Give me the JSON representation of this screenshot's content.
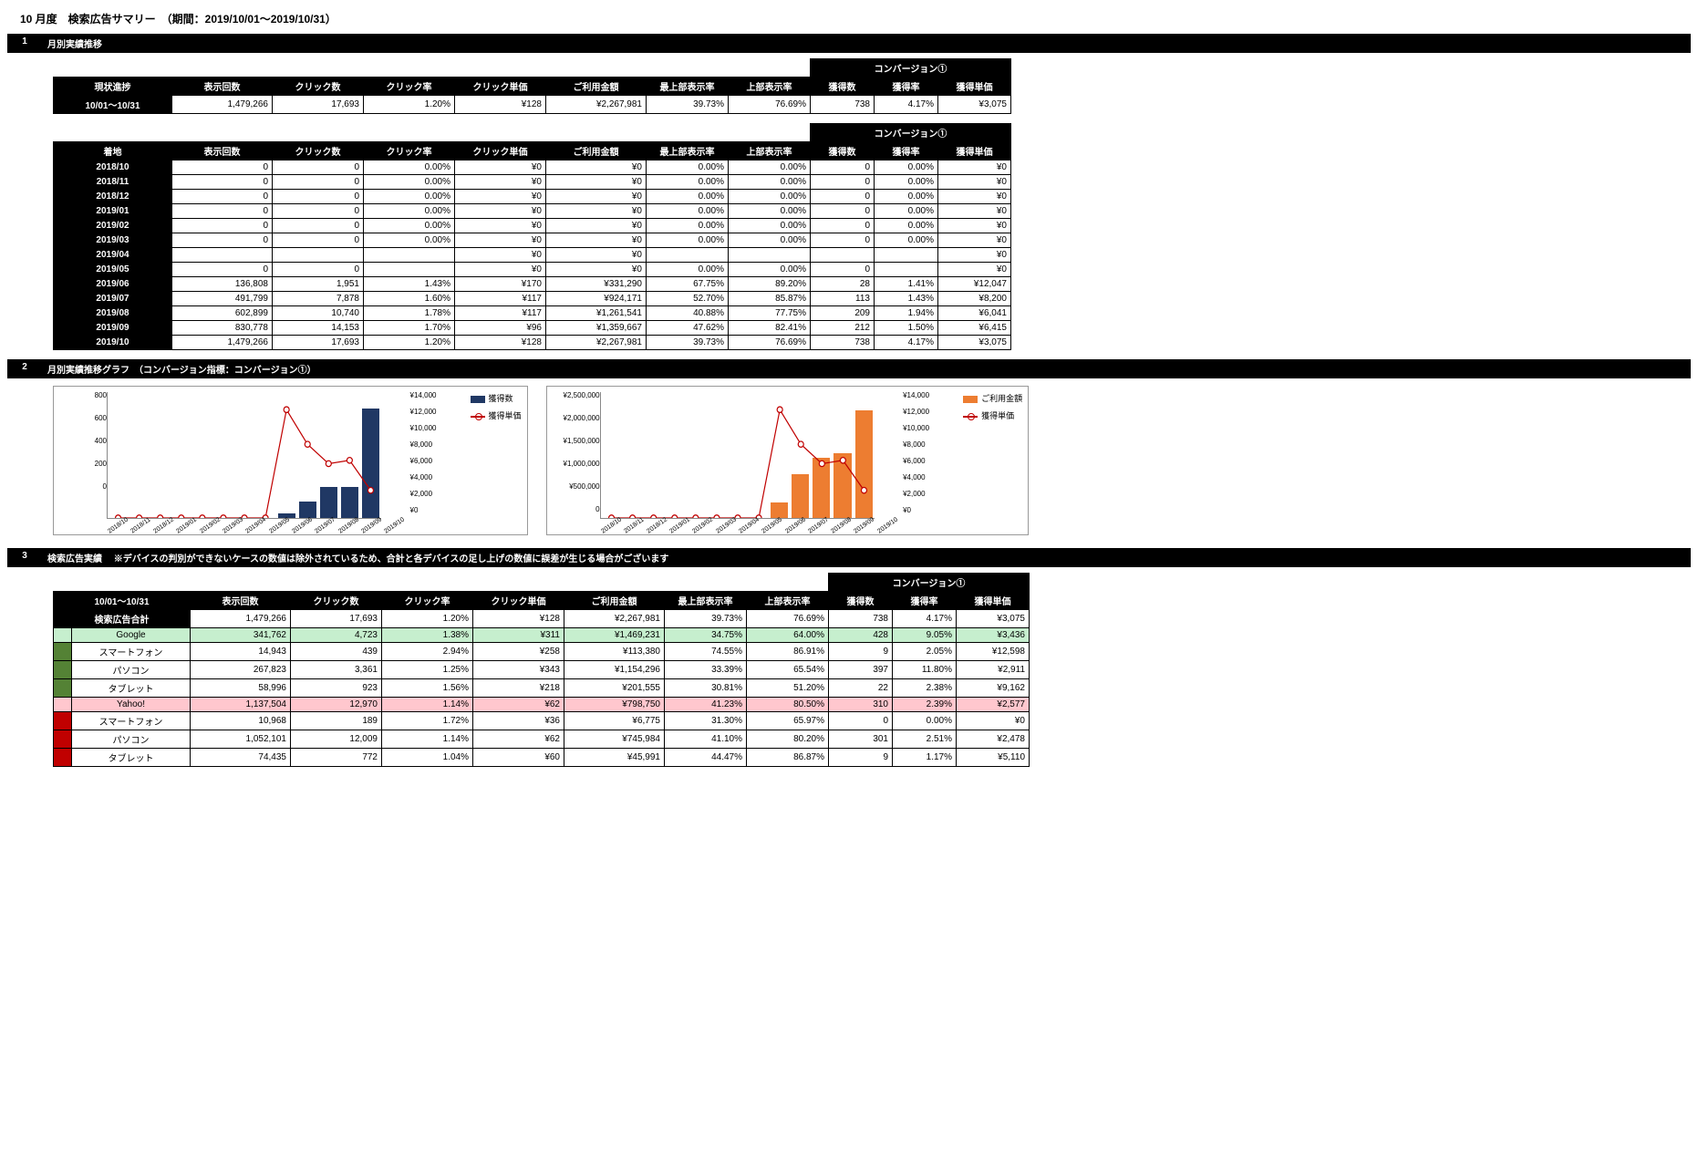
{
  "title": "10 月度　検索広告サマリー　（期間：2019/10/01～2019/10/31）",
  "sections": {
    "s1": {
      "num": "1",
      "title": "月別実績推移"
    },
    "s2": {
      "num": "2",
      "title": "月別実績推移グラフ　（コンバージョン指標：コンバージョン①）"
    },
    "s3": {
      "num": "3",
      "title": "検索広告実績　 ※デバイスの判別ができないケースの数値は除外されているため、合計と各デバイスの足し上げの数値に誤差が生じる場合がございます"
    }
  },
  "col_headers": [
    "表示回数",
    "クリック数",
    "クリック率",
    "クリック単価",
    "ご利用金額",
    "最上部表示率",
    "上部表示率",
    "獲得数",
    "獲得率",
    "獲得単価"
  ],
  "conv_header": "コンバージョン①",
  "progress": {
    "label": "現状進捗",
    "period": "10/01～10/31",
    "row": [
      "1,479,266",
      "17,693",
      "1.20%",
      "¥128",
      "¥2,267,981",
      "39.73%",
      "76.69%",
      "738",
      "4.17%",
      "¥3,075"
    ]
  },
  "landing_label": "着地",
  "landing_rows": [
    {
      "h": "2018/10",
      "v": [
        "0",
        "0",
        "0.00%",
        "¥0",
        "¥0",
        "0.00%",
        "0.00%",
        "0",
        "0.00%",
        "¥0"
      ]
    },
    {
      "h": "2018/11",
      "v": [
        "0",
        "0",
        "0.00%",
        "¥0",
        "¥0",
        "0.00%",
        "0.00%",
        "0",
        "0.00%",
        "¥0"
      ]
    },
    {
      "h": "2018/12",
      "v": [
        "0",
        "0",
        "0.00%",
        "¥0",
        "¥0",
        "0.00%",
        "0.00%",
        "0",
        "0.00%",
        "¥0"
      ]
    },
    {
      "h": "2019/01",
      "v": [
        "0",
        "0",
        "0.00%",
        "¥0",
        "¥0",
        "0.00%",
        "0.00%",
        "0",
        "0.00%",
        "¥0"
      ]
    },
    {
      "h": "2019/02",
      "v": [
        "0",
        "0",
        "0.00%",
        "¥0",
        "¥0",
        "0.00%",
        "0.00%",
        "0",
        "0.00%",
        "¥0"
      ]
    },
    {
      "h": "2019/03",
      "v": [
        "0",
        "0",
        "0.00%",
        "¥0",
        "¥0",
        "0.00%",
        "0.00%",
        "0",
        "0.00%",
        "¥0"
      ]
    },
    {
      "h": "2019/04",
      "v": [
        "",
        "",
        "",
        "¥0",
        "¥0",
        "",
        "",
        "",
        "",
        "¥0"
      ]
    },
    {
      "h": "2019/05",
      "v": [
        "0",
        "0",
        "",
        "¥0",
        "¥0",
        "0.00%",
        "0.00%",
        "0",
        "",
        "¥0"
      ]
    },
    {
      "h": "2019/06",
      "v": [
        "136,808",
        "1,951",
        "1.43%",
        "¥170",
        "¥331,290",
        "67.75%",
        "89.20%",
        "28",
        "1.41%",
        "¥12,047"
      ]
    },
    {
      "h": "2019/07",
      "v": [
        "491,799",
        "7,878",
        "1.60%",
        "¥117",
        "¥924,171",
        "52.70%",
        "85.87%",
        "113",
        "1.43%",
        "¥8,200"
      ]
    },
    {
      "h": "2019/08",
      "v": [
        "602,899",
        "10,740",
        "1.78%",
        "¥117",
        "¥1,261,541",
        "40.88%",
        "77.75%",
        "209",
        "1.94%",
        "¥6,041"
      ]
    },
    {
      "h": "2019/09",
      "v": [
        "830,778",
        "14,153",
        "1.70%",
        "¥96",
        "¥1,359,667",
        "47.62%",
        "82.41%",
        "212",
        "1.50%",
        "¥6,415"
      ]
    },
    {
      "h": "2019/10",
      "v": [
        "1,479,266",
        "17,693",
        "1.20%",
        "¥128",
        "¥2,267,981",
        "39.73%",
        "76.69%",
        "738",
        "4.17%",
        "¥3,075"
      ]
    }
  ],
  "search_label": "10/01～10/31",
  "search_rows": [
    {
      "cls": "",
      "bar": "",
      "h": "検索広告合計",
      "v": [
        "1,479,266",
        "17,693",
        "1.20%",
        "¥128",
        "¥2,267,981",
        "39.73%",
        "76.69%",
        "738",
        "4.17%",
        "¥3,075"
      ]
    },
    {
      "cls": "google",
      "bar": "green-bar",
      "h": "Google",
      "v": [
        "341,762",
        "4,723",
        "1.38%",
        "¥311",
        "¥1,469,231",
        "34.75%",
        "64.00%",
        "428",
        "9.05%",
        "¥3,436"
      ]
    },
    {
      "cls": "",
      "bar": "green-bar",
      "h": "スマートフォン",
      "v": [
        "14,943",
        "439",
        "2.94%",
        "¥258",
        "¥113,380",
        "74.55%",
        "86.91%",
        "9",
        "2.05%",
        "¥12,598"
      ]
    },
    {
      "cls": "",
      "bar": "green-bar",
      "h": "パソコン",
      "v": [
        "267,823",
        "3,361",
        "1.25%",
        "¥343",
        "¥1,154,296",
        "33.39%",
        "65.54%",
        "397",
        "11.80%",
        "¥2,911"
      ]
    },
    {
      "cls": "",
      "bar": "green-bar",
      "h": "タブレット",
      "v": [
        "58,996",
        "923",
        "1.56%",
        "¥218",
        "¥201,555",
        "30.81%",
        "51.20%",
        "22",
        "2.38%",
        "¥9,162"
      ]
    },
    {
      "cls": "yahoo",
      "bar": "red-bar",
      "h": "Yahoo!",
      "v": [
        "1,137,504",
        "12,970",
        "1.14%",
        "¥62",
        "¥798,750",
        "41.23%",
        "80.50%",
        "310",
        "2.39%",
        "¥2,577"
      ]
    },
    {
      "cls": "",
      "bar": "red-bar",
      "h": "スマートフォン",
      "v": [
        "10,968",
        "189",
        "1.72%",
        "¥36",
        "¥6,775",
        "31.30%",
        "65.97%",
        "0",
        "0.00%",
        "¥0"
      ]
    },
    {
      "cls": "",
      "bar": "red-bar",
      "h": "パソコン",
      "v": [
        "1,052,101",
        "12,009",
        "1.14%",
        "¥62",
        "¥745,984",
        "41.10%",
        "80.20%",
        "301",
        "2.51%",
        "¥2,478"
      ]
    },
    {
      "cls": "",
      "bar": "red-bar",
      "h": "タブレット",
      "v": [
        "74,435",
        "772",
        "1.04%",
        "¥60",
        "¥45,991",
        "44.47%",
        "86.87%",
        "9",
        "1.17%",
        "¥5,110"
      ]
    }
  ],
  "chart_data": [
    {
      "type": "combo",
      "categories": [
        "2018/10",
        "2018/11",
        "2018/12",
        "2019/01",
        "2019/02",
        "2019/03",
        "2019/04",
        "2019/05",
        "2019/06",
        "2019/07",
        "2019/08",
        "2019/09",
        "2019/10"
      ],
      "series": [
        {
          "name": "獲得数",
          "type": "bar",
          "values": [
            0,
            0,
            0,
            0,
            0,
            0,
            0,
            0,
            28,
            113,
            209,
            212,
            738
          ],
          "color": "#203864",
          "axis": "left"
        },
        {
          "name": "獲得単価",
          "type": "line",
          "values": [
            0,
            0,
            0,
            0,
            0,
            0,
            0,
            0,
            12047,
            8200,
            6041,
            6415,
            3075
          ],
          "color": "#c00000",
          "axis": "right"
        }
      ],
      "y_left": {
        "min": 0,
        "max": 800,
        "step": 200
      },
      "y_right": {
        "min": 0,
        "max": 14000,
        "step": 2000
      }
    },
    {
      "type": "combo",
      "categories": [
        "2018/10",
        "2018/11",
        "2018/12",
        "2019/01",
        "2019/02",
        "2019/03",
        "2019/04",
        "2019/05",
        "2019/06",
        "2019/07",
        "2019/08",
        "2019/09",
        "2019/10"
      ],
      "series": [
        {
          "name": "ご利用金額",
          "type": "bar",
          "values": [
            0,
            0,
            0,
            0,
            0,
            0,
            0,
            0,
            331290,
            924171,
            1261541,
            1359667,
            2267981
          ],
          "color": "#ed7d31",
          "axis": "left"
        },
        {
          "name": "獲得単価",
          "type": "line",
          "values": [
            0,
            0,
            0,
            0,
            0,
            0,
            0,
            0,
            12047,
            8200,
            6041,
            6415,
            3075
          ],
          "color": "#c00000",
          "axis": "right"
        }
      ],
      "y_left": {
        "min": 0,
        "max": 2500000,
        "step": 500000
      },
      "y_right": {
        "min": 0,
        "max": 14000,
        "step": 2000
      }
    }
  ]
}
